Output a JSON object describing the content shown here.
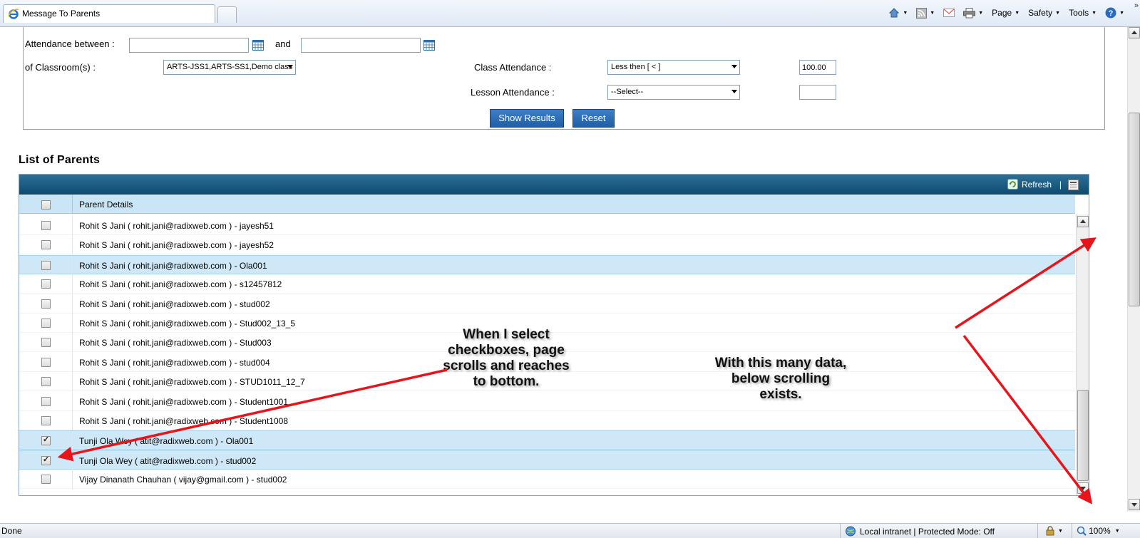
{
  "browser": {
    "tab_title": "Message To Parents",
    "toolbar": {
      "page_label": "Page",
      "safety_label": "Safety",
      "tools_label": "Tools",
      "chevron": "»"
    },
    "status": {
      "left_text": "Done",
      "zone_text": "Local intranet | Protected Mode: Off",
      "zoom_text": "100%"
    }
  },
  "filters": {
    "attendance_between_label": "Attendance between :",
    "and_label": "and",
    "date_from_value": "",
    "date_to_value": "",
    "classrooms_label": "of Classroom(s) :",
    "classrooms_value": "ARTS-JSS1,ARTS-SS1,Demo class",
    "class_attendance_label": "Class Attendance :",
    "class_attendance_operator": "Less then [ < ]",
    "class_attendance_value": "100.00",
    "lesson_attendance_label": "Lesson Attendance :",
    "lesson_attendance_operator": "--Select--",
    "lesson_attendance_value": "",
    "show_results_label": "Show Results",
    "reset_label": "Reset"
  },
  "list": {
    "title": "List of Parents",
    "refresh_label": "Refresh",
    "separator": "|",
    "column_header": "Parent Details",
    "rows": [
      {
        "text": "Rohit S Jani ( rohit.jani@radixweb.com ) - jayesh51",
        "checked": false,
        "highlighted": false
      },
      {
        "text": "Rohit S Jani ( rohit.jani@radixweb.com ) - jayesh52",
        "checked": false,
        "highlighted": false
      },
      {
        "text": "Rohit S Jani ( rohit.jani@radixweb.com ) - Ola001",
        "checked": false,
        "highlighted": true
      },
      {
        "text": "Rohit S Jani ( rohit.jani@radixweb.com ) - s12457812",
        "checked": false,
        "highlighted": false
      },
      {
        "text": "Rohit S Jani ( rohit.jani@radixweb.com ) - stud002",
        "checked": false,
        "highlighted": false
      },
      {
        "text": "Rohit S Jani ( rohit.jani@radixweb.com ) - Stud002_13_5",
        "checked": false,
        "highlighted": false
      },
      {
        "text": "Rohit S Jani ( rohit.jani@radixweb.com ) - Stud003",
        "checked": false,
        "highlighted": false
      },
      {
        "text": "Rohit S Jani ( rohit.jani@radixweb.com ) - stud004",
        "checked": false,
        "highlighted": false
      },
      {
        "text": "Rohit S Jani ( rohit.jani@radixweb.com ) - STUD1011_12_7",
        "checked": false,
        "highlighted": false
      },
      {
        "text": "Rohit S Jani ( rohit.jani@radixweb.com ) - Student1001",
        "checked": false,
        "highlighted": false
      },
      {
        "text": "Rohit S Jani ( rohit.jani@radixweb.com ) - Student1008",
        "checked": false,
        "highlighted": false
      },
      {
        "text": "Tunji Ola Wey ( atit@radixweb.com ) - Ola001",
        "checked": true,
        "highlighted": true
      },
      {
        "text": "Tunji Ola Wey ( atit@radixweb.com ) - stud002",
        "checked": true,
        "highlighted": true
      },
      {
        "text": "Vijay Dinanath Chauhan ( vijay@gmail.com ) - stud002",
        "checked": false,
        "highlighted": false
      }
    ]
  },
  "annotations": {
    "left_note_lines": [
      "When I select",
      "checkboxes, page",
      "scrolls and reaches",
      "to bottom."
    ],
    "right_note_lines": [
      "With this many data,",
      "below scrolling",
      "exists."
    ],
    "arrow_color": "#e8141b"
  }
}
